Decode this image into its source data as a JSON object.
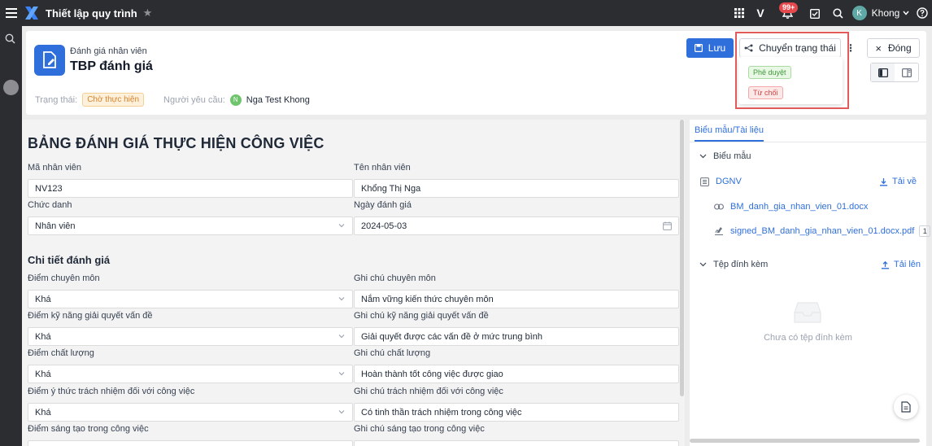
{
  "app": {
    "title": "Thiết lập quy trình",
    "notifications": "99+",
    "user_initial": "K",
    "user_name": "Khong"
  },
  "header": {
    "breadcrumb": "Đánh giá nhân viên",
    "title": "TBP đánh giá",
    "status_label": "Trạng thái:",
    "status_value": "Chờ thực hiện",
    "requester_label": "Người yêu cầu:",
    "requester_initial": "N",
    "requester_name": "Nga Test Khong",
    "save_label": "Lưu",
    "transition_label": "Chuyển trạng thái",
    "close_label": "Đóng"
  },
  "status_dropdown": {
    "approve": "Phê duyệt",
    "reject": "Từ chối"
  },
  "form": {
    "title": "BẢNG ĐÁNH GIÁ THỰC HIỆN CÔNG VIỆC",
    "employee_id_label": "Mã nhân viên",
    "employee_id": "NV123",
    "employee_name_label": "Tên nhân viên",
    "employee_name": "Khổng Thị Nga",
    "position_label": "Chức danh",
    "position": "Nhân viên",
    "date_label": "Ngày đánh giá",
    "date": "2024-05-03",
    "section_title": "Chi tiết đánh giá",
    "rows": [
      {
        "score_label": "Điểm chuyên môn",
        "score": "Khá",
        "note_label": "Ghi chú chuyên môn",
        "note": "Nắm vững kiến thức chuyên môn"
      },
      {
        "score_label": "Điểm kỹ năng giải quyết vấn đề",
        "score": "Khá",
        "note_label": "Ghi chú kỹ năng giải quyết vấn đề",
        "note": "Giải quyết được các vấn đề ở mức trung bình"
      },
      {
        "score_label": "Điểm chất lượng",
        "score": "Khá",
        "note_label": "Ghi chú chất lượng",
        "note": "Hoàn thành tốt công việc được giao"
      },
      {
        "score_label": "Điểm ý thức trách nhiệm đối với công việc",
        "score": "Khá",
        "note_label": "Ghi chú trách nhiệm đối với công việc",
        "note": "Có tinh thần trách nhiệm trong công việc"
      },
      {
        "score_label": "Điểm sáng tạo trong công việc",
        "score": "",
        "note_label": "Ghi chú sáng tạo trong công việc",
        "note": ""
      }
    ]
  },
  "side": {
    "tab_label": "Biểu mẫu/Tài liệu",
    "templates_label": "Biểu mẫu",
    "template_name": "DGNV",
    "download_label": "Tải về",
    "file1": "BM_danh_gia_nhan_vien_01.docx",
    "file2": "signed_BM_danh_gia_nhan_vien_01.docx.pdf",
    "file2_count": "1",
    "attachments_label": "Tệp đính kèm",
    "upload_label": "Tải lên",
    "empty_text": "Chưa có tệp đính kèm"
  }
}
